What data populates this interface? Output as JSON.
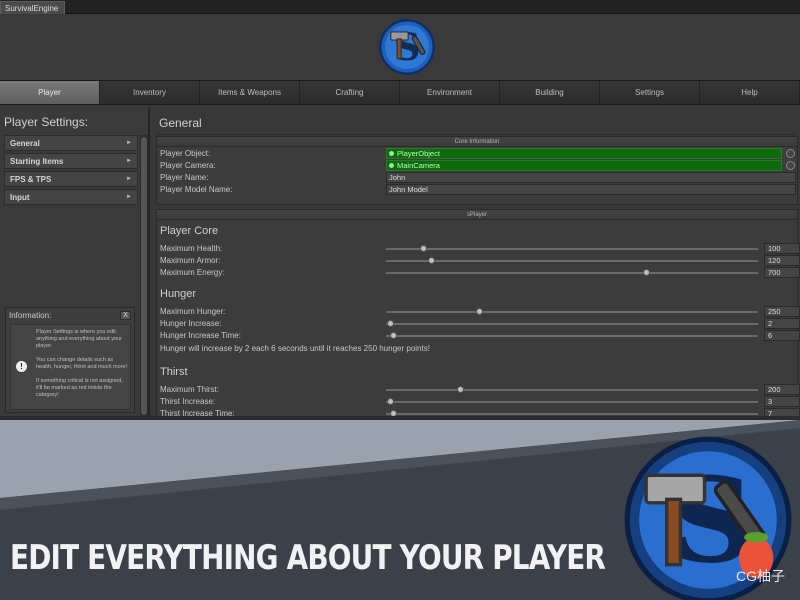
{
  "window": {
    "tab_label": "SurvivalEngine"
  },
  "nav": {
    "tabs": [
      "Player",
      "Inventory",
      "Items & Weapons",
      "Crafting",
      "Environment",
      "Building",
      "Settings",
      "Help"
    ],
    "active": "Player"
  },
  "left": {
    "title": "Player Settings:",
    "categories": [
      "General",
      "Starting Items",
      "FPS & TPS",
      "Input"
    ],
    "info": {
      "title": "Information:",
      "close": "X",
      "icon": "!",
      "text_1": "Player Settings is where you edit anything and everything about your player.",
      "text_2": "You can change details such as health, hunger, thirst and much more!",
      "text_3": "If something critical is not assigned, it'll be marked as red inside the category!"
    }
  },
  "main": {
    "title": "General",
    "core": {
      "header": "Core Information",
      "player_object_label": "Player Object:",
      "player_object_value": "PlayerObject",
      "player_camera_label": "Player Camera:",
      "player_camera_value": "MainCamera",
      "player_name_label": "Player Name:",
      "player_name_value": "John",
      "player_model_label": "Player Model Name:",
      "player_model_value": "John Model"
    },
    "player": {
      "header": "sPlayer",
      "core_heading": "Player Core",
      "max_health_label": "Maximum Health:",
      "max_health_value": "100",
      "max_armor_label": "Maximum Armor:",
      "max_armor_value": "120",
      "max_energy_label": "Maximum Energy:",
      "max_energy_value": "700",
      "hunger_heading": "Hunger",
      "max_hunger_label": "Maximum Hunger:",
      "max_hunger_value": "250",
      "hunger_increase_label": "Hunger Increase:",
      "hunger_increase_value": "2",
      "hunger_time_label": "Hunger Increase Time:",
      "hunger_time_value": "6",
      "hunger_note": "Hunger will increase by 2 each 6 seconds until it reaches 250 hunger points!",
      "thirst_heading": "Thirst",
      "max_thirst_label": "Maximum Thirst:",
      "max_thirst_value": "200",
      "thirst_increase_label": "Thirst Increase:",
      "thirst_increase_value": "3",
      "thirst_time_label": "Thirst Increase Time:",
      "thirst_time_value": "7"
    },
    "slider_levels": {
      "max_health": 0.1,
      "max_armor": 0.12,
      "max_energy": 0.7,
      "max_hunger": 0.25,
      "hunger_increase": 0.01,
      "hunger_time": 0.02,
      "max_thirst": 0.2,
      "thirst_increase": 0.01,
      "thirst_time": 0.02
    }
  },
  "banner": {
    "caption": "EDIT EVERYTHING ABOUT YOUR PLAYER",
    "watermark": "CG柚子"
  },
  "colors": {
    "object_field": "#0d6a0d",
    "active_tab": "#6e6e6e",
    "banner_bg": "#3b4049",
    "logo_blue": "#1f5fb8"
  },
  "icons": [
    "hammer-s-logo",
    "info-icon",
    "close-icon",
    "chevron-right-icon",
    "object-picker-icon"
  ]
}
